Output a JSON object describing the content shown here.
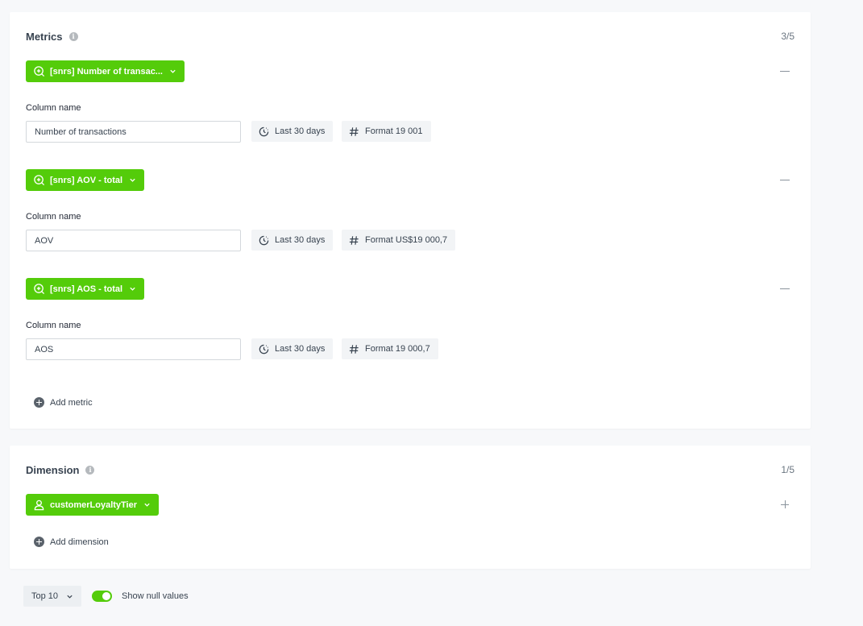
{
  "metrics": {
    "title": "Metrics",
    "counter": "3/5",
    "items": [
      {
        "pill_label": "[snrs] Number of transac...",
        "column_label": "Column name",
        "column_value": "Number of transactions",
        "period": "Last 30 days",
        "format": "Format 19 001"
      },
      {
        "pill_label": "[snrs] AOV - total",
        "column_label": "Column name",
        "column_value": "AOV",
        "period": "Last 30 days",
        "format": "Format US$19 000,7"
      },
      {
        "pill_label": "[snrs] AOS - total",
        "column_label": "Column name",
        "column_value": "AOS",
        "period": "Last 30 days",
        "format": "Format 19 000,7"
      }
    ],
    "add_label": "Add metric"
  },
  "dimension": {
    "title": "Dimension",
    "counter": "1/5",
    "pill_label": "customerLoyaltyTier",
    "add_label": "Add dimension"
  },
  "footer": {
    "top_select": "Top 10",
    "show_null_label": "Show null values",
    "show_null_enabled": true
  },
  "icons": {
    "info": "info-icon",
    "metric": "search-plus-icon",
    "dimension": "user-icon",
    "period": "clock-icon",
    "format": "hash-icon",
    "chevron": "chevron-down-icon"
  },
  "colors": {
    "accent": "#54cc0a",
    "text": "#384350",
    "background": "#f7f8fa",
    "chip": "#f2f4f6"
  }
}
